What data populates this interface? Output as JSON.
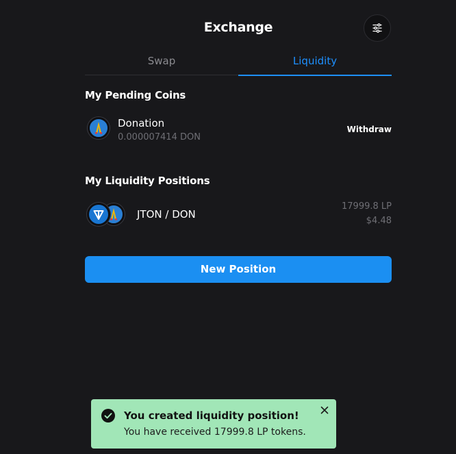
{
  "header": {
    "title": "Exchange",
    "settings_icon": "sliders-icon"
  },
  "tabs": [
    {
      "label": "Swap",
      "active": false
    },
    {
      "label": "Liquidity",
      "active": true
    }
  ],
  "pending": {
    "title": "My Pending Coins",
    "items": [
      {
        "name": "Donation",
        "amount": "0.000007414 DON",
        "action": "Withdraw",
        "icon": "don-coin-icon"
      }
    ]
  },
  "positions": {
    "title": "My Liquidity Positions",
    "items": [
      {
        "pair": "JTON / DON",
        "lp": "17999.8 LP",
        "value": "$4.48",
        "icons": [
          "jton-coin-icon",
          "don-coin-icon"
        ]
      }
    ]
  },
  "new_position_label": "New Position",
  "toast": {
    "title": "You created liquidity position!",
    "message": "You have received 17999.8 LP tokens.",
    "background": "#a1e6b7",
    "icon": "check-circle-icon",
    "close_icon": "close-icon"
  },
  "colors": {
    "accent": "#1e90ff",
    "background": "#18181b"
  }
}
